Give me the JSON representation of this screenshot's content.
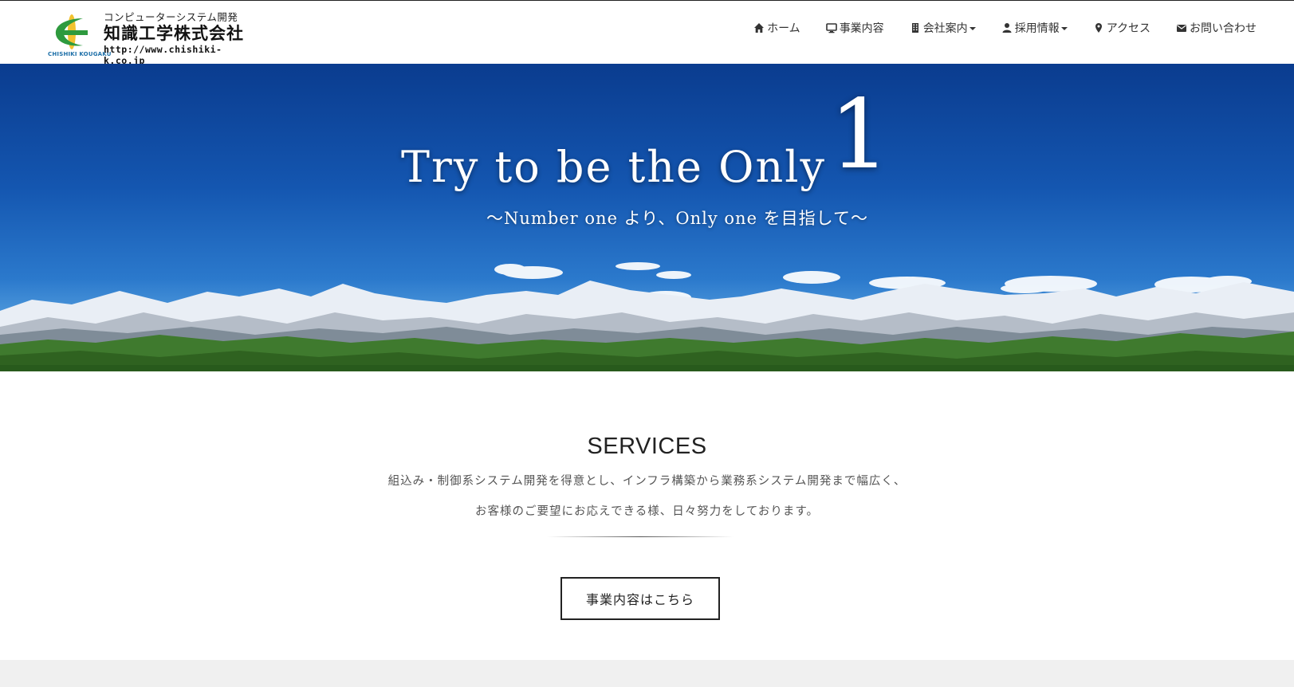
{
  "header": {
    "logo": {
      "subtitle": "コンピューターシステム開発",
      "name": "知識工学株式会社",
      "url": "http://www.chishiki-k.co.jp",
      "en_name": "CHISHIKI KOUGAKU"
    },
    "nav": [
      {
        "label": "ホーム",
        "icon": "home-icon"
      },
      {
        "label": "事業内容",
        "icon": "monitor-icon"
      },
      {
        "label": "会社案内",
        "icon": "building-icon",
        "dropdown": true
      },
      {
        "label": "採用情報",
        "icon": "user-icon",
        "dropdown": true
      },
      {
        "label": "アクセス",
        "icon": "map-marker-icon"
      },
      {
        "label": "お問い合わせ",
        "icon": "envelope-icon"
      }
    ]
  },
  "hero": {
    "title": "Try to be the Only",
    "number": "1",
    "subtitle": "〜Number one より、Only one を目指して〜"
  },
  "services": {
    "title": "SERVICES",
    "line1": "組込み・制御系システム開発を得意とし、インフラ構築から業務系システム開発まで幅広く、",
    "line2": "お客様のご要望にお応えできる様、日々努力をしております。",
    "button": "事業内容はこちら"
  },
  "colors": {
    "sky_top": "#0a3c8f",
    "logo_green": "#2e9a3e",
    "logo_yellow": "#f2c230",
    "logo_blue": "#1d6fa8"
  }
}
